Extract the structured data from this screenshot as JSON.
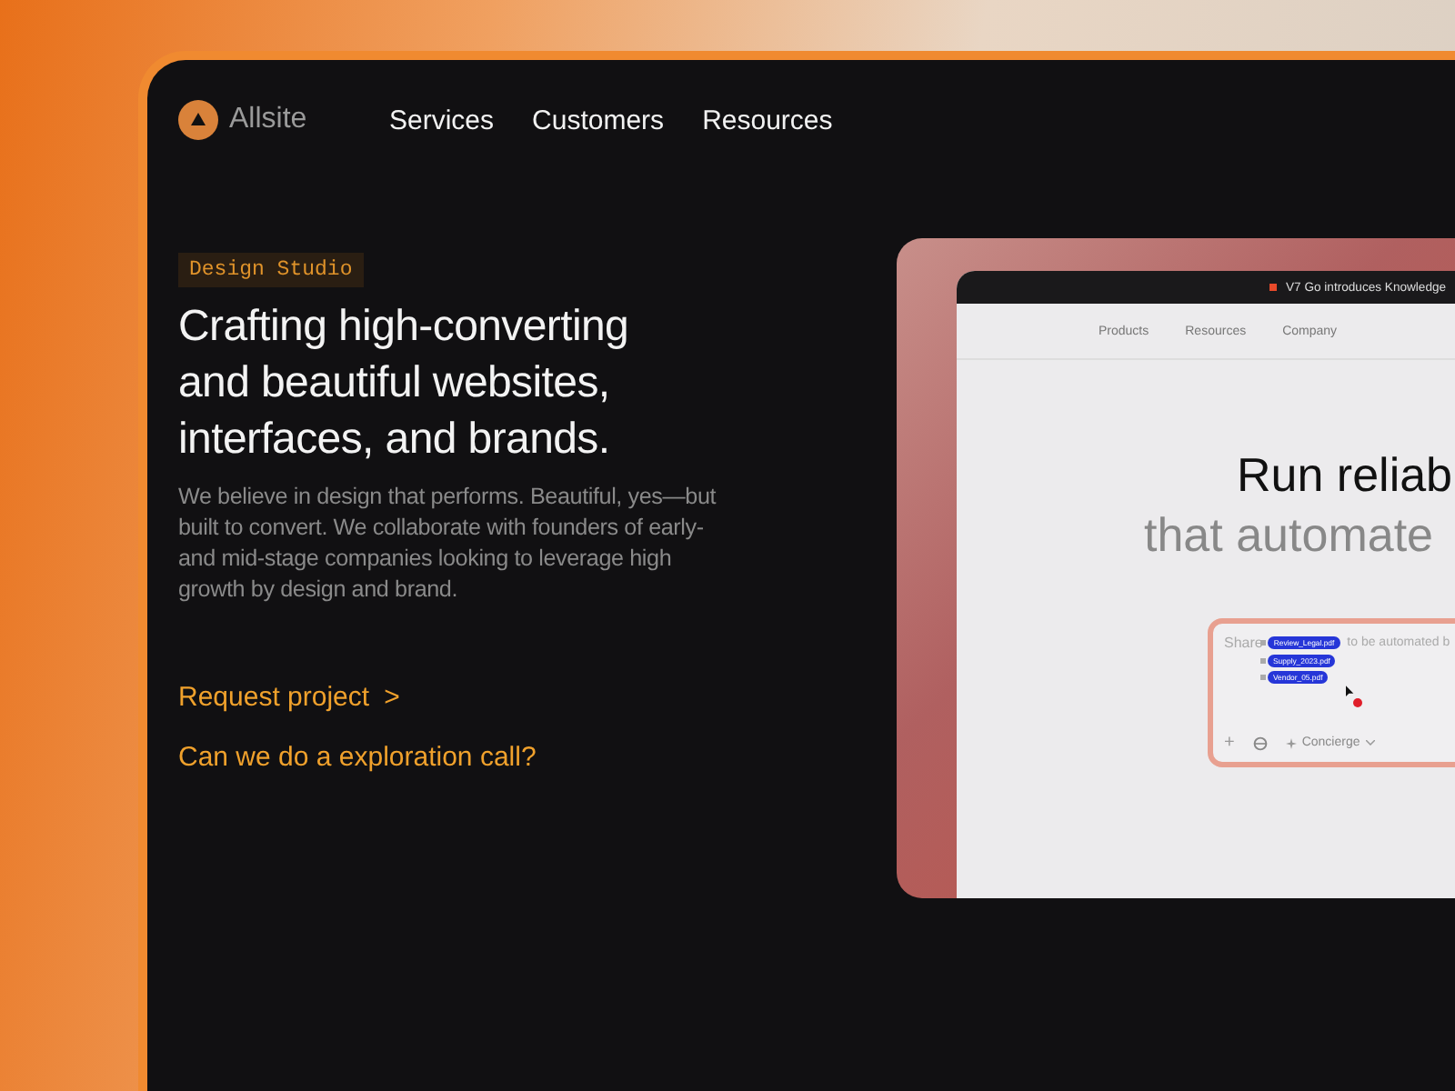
{
  "brand": {
    "name": "Allsite"
  },
  "nav": [
    {
      "label": "Services"
    },
    {
      "label": "Customers"
    },
    {
      "label": "Resources"
    }
  ],
  "hero": {
    "tag": "Design Studio",
    "heading": "Crafting high-converting and beautiful websites, interfaces, and brands.",
    "body": "We believe in design that performs. Beautiful, yes—but built to convert. We collaborate with founders of early- and mid-stage companies looking to leverage high growth by design and brand.",
    "primary_link": "Request project",
    "primary_link_icon": ">",
    "secondary_link": "Can we do a exploration call?"
  },
  "preview": {
    "announcement": "V7 Go introduces Knowledge",
    "nav": [
      {
        "label": "Products"
      },
      {
        "label": "Resources"
      },
      {
        "label": "Company"
      }
    ],
    "headline": "Run reliab",
    "subheadline": "that automate",
    "prompt_start": "Share",
    "prompt_end": "to be automated b",
    "files": [
      {
        "name": "Review_Legal.pdf"
      },
      {
        "name": "Supply_2023.pdf"
      },
      {
        "name": "Vendor_05.pdf"
      }
    ],
    "add_label": "+",
    "agent": "Concierge"
  }
}
